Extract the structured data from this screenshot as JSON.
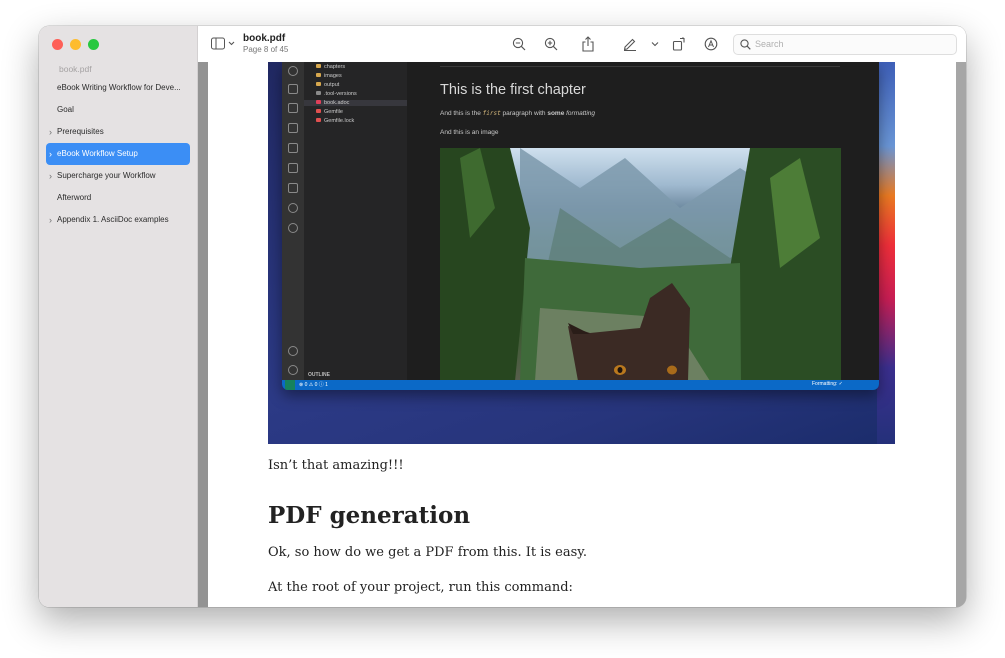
{
  "sidebar": {
    "title": "book.pdf",
    "items": [
      {
        "label": "eBook Writing Workflow for Deve...",
        "chevron": false,
        "active": false
      },
      {
        "label": "Goal",
        "chevron": false,
        "active": false
      },
      {
        "label": "Prerequisites",
        "chevron": true,
        "active": false
      },
      {
        "label": "eBook Workflow Setup",
        "chevron": true,
        "active": true
      },
      {
        "label": "Supercharge your Workflow",
        "chevron": true,
        "active": false
      },
      {
        "label": "Afterword",
        "chevron": false,
        "active": false
      },
      {
        "label": "Appendix 1. AsciiDoc examples",
        "chevron": true,
        "active": false
      }
    ]
  },
  "toolbar": {
    "doc_title": "book.pdf",
    "page_info": "Page 8 of 45",
    "search_placeholder": "Search"
  },
  "screenshot": {
    "explorer": [
      {
        "name": "chapters",
        "kind": "folder"
      },
      {
        "name": "images",
        "kind": "folder"
      },
      {
        "name": "output",
        "kind": "folder"
      },
      {
        "name": ".tool-versions",
        "kind": "file"
      },
      {
        "name": "book.adoc",
        "kind": "adoc"
      },
      {
        "name": "Gemfile",
        "kind": "ruby"
      },
      {
        "name": "Gemfile.lock",
        "kind": "ruby"
      }
    ],
    "outline_label": "OUTLINE",
    "editor_heading": "This is the first chapter",
    "para_prefix": "And this is the",
    "para_code": "first",
    "para_middle": "paragraph with",
    "para_bold": "some",
    "para_italic": "formatting",
    "para2": "And this is an image",
    "status_left": "⊗ 0 ⚠ 0 ⓘ 1",
    "status_right": "Formatting: ✓"
  },
  "document": {
    "caption": "Isn’t that amazing!!!",
    "heading": "PDF generation",
    "para1": "Ok, so how do we get a PDF from this. It is easy.",
    "para2": "At the root of your project, run this command:"
  }
}
